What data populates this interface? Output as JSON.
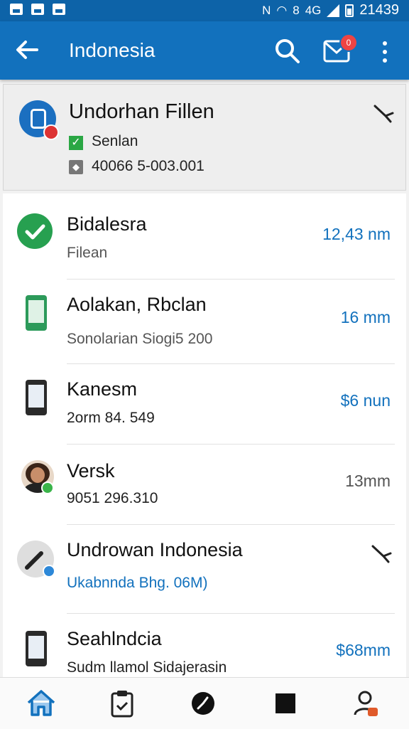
{
  "status_bar": {
    "time": "21439",
    "icons": [
      "image-icon",
      "image-icon",
      "image-icon",
      "nfc-icon",
      "wifi-icon",
      "vibrate-icon",
      "data-icon",
      "signal-icon",
      "battery-icon"
    ],
    "network_label": "4G"
  },
  "app_bar": {
    "title": "Indonesia",
    "mail_badge": "0",
    "actions": [
      "search-icon",
      "mail-icon",
      "more-vert-icon"
    ]
  },
  "header_card": {
    "name": "Undorhan Fillen",
    "status": "Senlan",
    "code": "40066 5-003.001",
    "colors": {
      "avatar": "#1b6fc0",
      "check": "#2aa744"
    }
  },
  "list": {
    "items": [
      {
        "title": "Bidalesra",
        "subtitle": "Filean",
        "value": "12,43 nm",
        "icon": "check-circle-icon"
      },
      {
        "title": "Aolakan, Rbclan",
        "subtitle": "Sonolarian Siogi5 200",
        "value": "16 mm",
        "icon": "phone-icon"
      },
      {
        "title": "Kanesm",
        "subtitle": "2orm 84. 549",
        "value": "$6 nun",
        "icon": "phone-icon"
      },
      {
        "title": "Versk",
        "subtitle": "9051 296.310",
        "value": "13mm",
        "icon": "avatar-icon"
      },
      {
        "title": "Undrowan Indonesia",
        "subtitle": "Ukabnnda Bhg. 06M)",
        "value": "",
        "icon": "pen-icon"
      },
      {
        "title": "Seahlndcia",
        "subtitle": "Sudm llamol Sidajerasin",
        "value": "$68mm",
        "icon": "phone-icon"
      }
    ]
  },
  "bottom_nav": {
    "items": [
      "home-icon",
      "clipboard-icon",
      "clock-icon",
      "square-icon",
      "profile-icon"
    ]
  },
  "colors": {
    "primary": "#1271bd",
    "status_bar": "#0d63a8",
    "badge": "#e44444"
  }
}
